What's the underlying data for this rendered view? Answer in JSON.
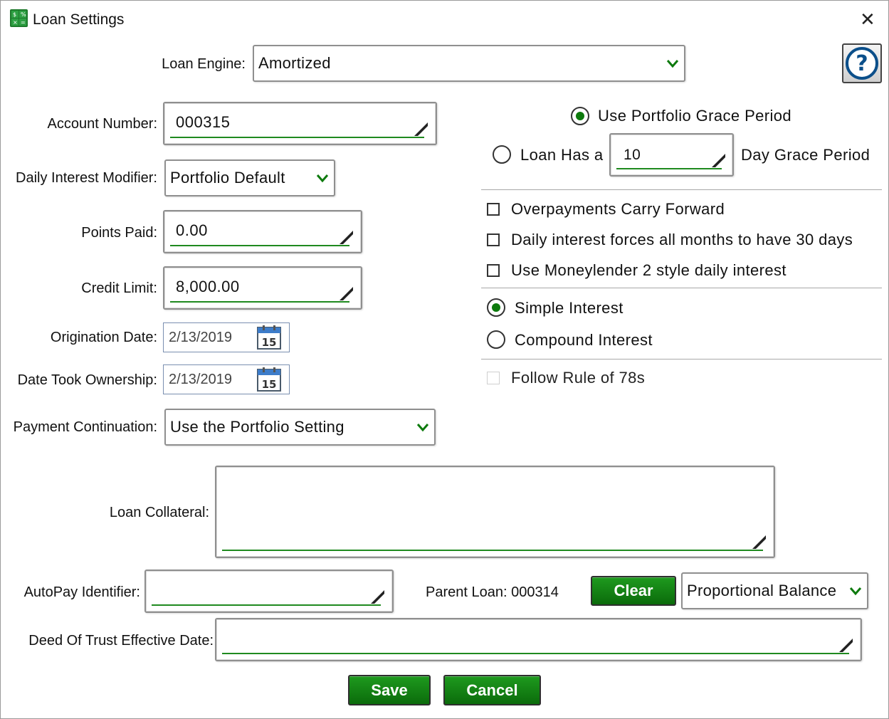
{
  "window": {
    "title": "Loan Settings",
    "close_glyph": "✕",
    "app_icon": "calculator-icon"
  },
  "loan_engine": {
    "label": "Loan Engine:",
    "value": "Amortized"
  },
  "account_number": {
    "label": "Account Number:",
    "value": "000315"
  },
  "daily_interest_modifier": {
    "label": "Daily Interest Modifier:",
    "value": "Portfolio Default"
  },
  "points_paid": {
    "label": "Points Paid:",
    "value": "0.00"
  },
  "credit_limit": {
    "label": "Credit Limit:",
    "value": "8,000.00"
  },
  "origination_date": {
    "label": "Origination Date:",
    "value": "2/13/2019",
    "calendar_day": "15"
  },
  "date_took_ownership": {
    "label": "Date Took Ownership:",
    "value": "2/13/2019",
    "calendar_day": "15"
  },
  "payment_continuation": {
    "label": "Payment Continuation:",
    "value": "Use the Portfolio Setting"
  },
  "grace": {
    "use_portfolio_label": "Use Portfolio Grace Period",
    "use_portfolio_selected": true,
    "loan_has_prefix": "Loan Has a",
    "days_value": "10",
    "days_suffix": "Day Grace Period",
    "loan_has_selected": false
  },
  "options": {
    "overpayments_carry_forward": {
      "label": "Overpayments Carry Forward",
      "checked": false
    },
    "thirty_day_months": {
      "label": "Daily interest forces all months to have 30 days",
      "checked": false
    },
    "moneylender2": {
      "label": "Use Moneylender 2 style daily interest",
      "checked": false
    }
  },
  "interest_type": {
    "simple_label": "Simple Interest",
    "compound_label": "Compound Interest",
    "selected": "simple"
  },
  "rule_of_78s": {
    "label": "Follow Rule of 78s",
    "checked": false,
    "enabled": false
  },
  "loan_collateral": {
    "label": "Loan Collateral:",
    "value": ""
  },
  "autopay_identifier": {
    "label": "AutoPay Identifier:",
    "value": ""
  },
  "parent_loan": {
    "label": "Parent Loan: 000314",
    "clear_label": "Clear",
    "mode_value": "Proportional Balance"
  },
  "deed_of_trust": {
    "label": "Deed Of Trust Effective Date:",
    "value": ""
  },
  "buttons": {
    "save": "Save",
    "cancel": "Cancel",
    "help_glyph": "?"
  },
  "colors": {
    "accent_green": "#1f8a1f",
    "button_green": "#0b7a0b",
    "help_blue": "#0b4f8a"
  }
}
